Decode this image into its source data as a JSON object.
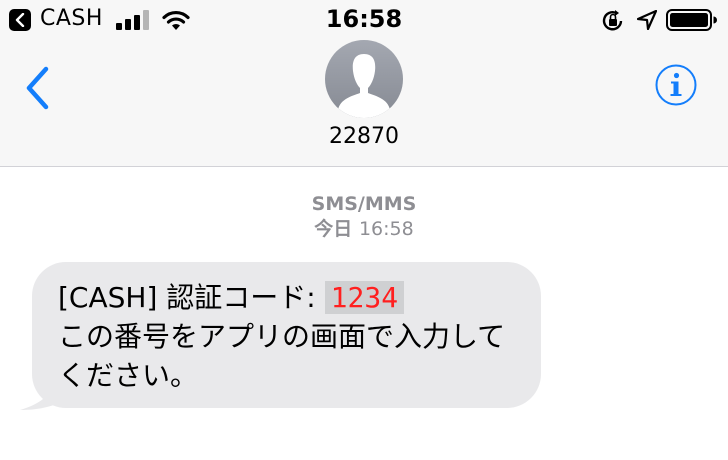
{
  "status_bar": {
    "back_app_label": "CASH",
    "time": "16:58",
    "icons": [
      "back-to-app-icon",
      "cellular-signal-icon",
      "wifi-icon",
      "orientation-lock-icon",
      "location-icon",
      "battery-icon"
    ]
  },
  "header": {
    "contact_name": "22870",
    "back_icon": "chevron-left-icon",
    "info_icon": "info-icon",
    "accent_color": "#147efb"
  },
  "conversation": {
    "service_label": "SMS/MMS",
    "timestamp_day": "今日",
    "timestamp_time": "16:58",
    "message": {
      "prefix": "[CASH] 認証コード:",
      "code": "1234",
      "body": "この番号をアプリの画面で入力してください。",
      "bubble_color": "#e9e9eb",
      "code_color": "#ff1f1f"
    }
  }
}
